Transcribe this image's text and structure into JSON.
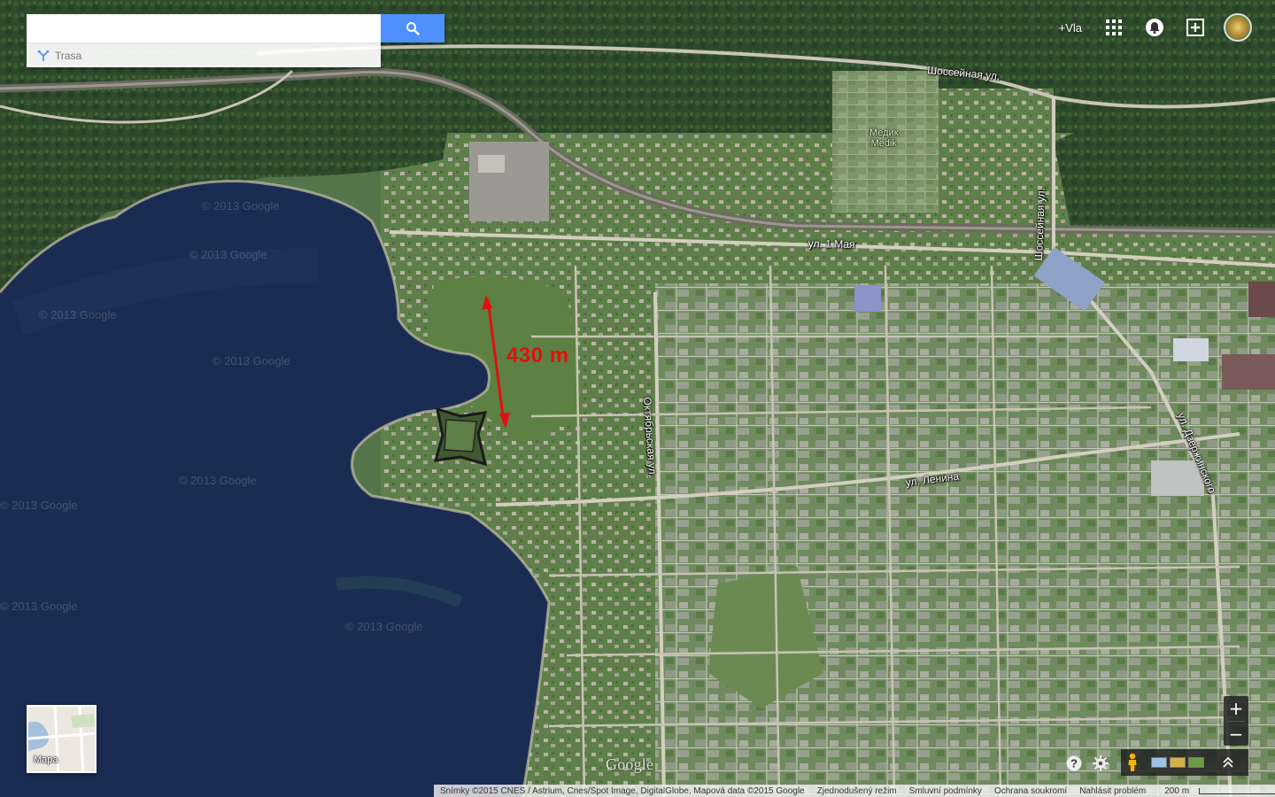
{
  "search": {
    "value": "",
    "placeholder": "",
    "route_label": "Trasa"
  },
  "topbar": {
    "plus_user": "+Vla"
  },
  "annotation": {
    "distance_label": "430 m",
    "arrow_color": "#e01010"
  },
  "streets": {
    "shosseinaya_top": "Шоссейная ул.",
    "shosseinaya_vertical": "Шоссейная ул.",
    "pervogo_maya": "ул. 1 Мая",
    "oktyabrskaya": "Октябрьская ул.",
    "lenina": "ул. Ленина",
    "dzerzhinskogo": "ул. Дзержинского"
  },
  "places": {
    "medik_ru": "Медик",
    "medik_cs": "Medik"
  },
  "watermark": "© 2013 Google",
  "minimap": {
    "label": "Mapa"
  },
  "zoom": {
    "in": "+",
    "out": "−"
  },
  "logo": "Google",
  "footer": {
    "attribution": "Snímky ©2015 CNES / Astrium, Cnes/Spot Image, DigitalGlobe, Mapová data ©2015 Google",
    "simplified_mode": "Zjednodušený režim",
    "terms": "Smluvní podmínky",
    "privacy": "Ochrana soukromí",
    "report": "Nahlásit problém",
    "scale_label": "200 m"
  },
  "colors": {
    "water": "#1b2c52",
    "land": "#5b7a4a",
    "search_button": "#4d90fe"
  }
}
